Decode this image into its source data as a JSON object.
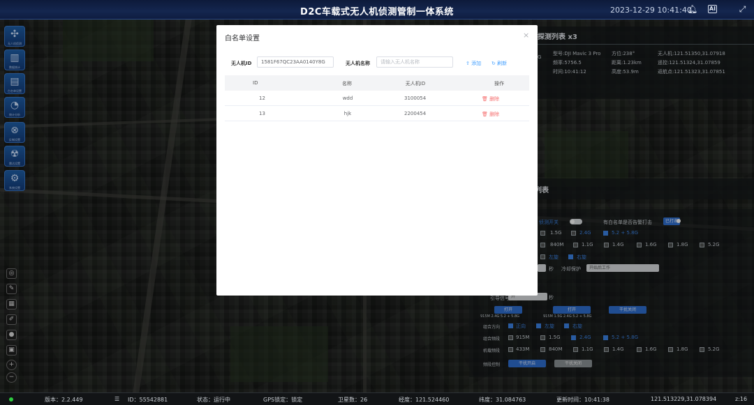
{
  "header": {
    "title": "D2C车载式无人机侦测管制一体系统",
    "datetime": "2023-12-29 10:41:40",
    "icons": [
      "bell-icon",
      "ai-icon",
      "fullscreen-icon"
    ]
  },
  "sidebar": {
    "buttons": [
      {
        "icon": "drone-icon",
        "glyph": "✣",
        "label": "无人机侦测"
      },
      {
        "icon": "bar-chart-icon",
        "glyph": "▥",
        "label": "数据统计"
      },
      {
        "icon": "document-icon",
        "glyph": "▤",
        "label": "白名单设置"
      },
      {
        "icon": "pie-chart-icon",
        "glyph": "◔",
        "label": "统计分析"
      },
      {
        "icon": "jammer-icon",
        "glyph": "⊗",
        "label": "反制设置"
      },
      {
        "icon": "radar-icon",
        "glyph": "☢",
        "label": "雷达设置"
      },
      {
        "icon": "settings-icon",
        "glyph": "⚙",
        "label": "系统设置"
      }
    ],
    "map_tools": [
      {
        "icon": "locate-icon",
        "glyph": "◎"
      },
      {
        "icon": "measure-icon",
        "glyph": "✎"
      },
      {
        "icon": "layers-icon",
        "glyph": "▦"
      },
      {
        "icon": "brush-icon",
        "glyph": "✐"
      },
      {
        "icon": "record-icon",
        "glyph": "●"
      },
      {
        "icon": "camera-icon",
        "glyph": "▣"
      },
      {
        "icon": "zoom-in-icon",
        "glyph": "+"
      },
      {
        "icon": "zoom-out-icon",
        "glyph": "−"
      }
    ]
  },
  "detect_panel": {
    "title": "探测列表 x3",
    "band": "G",
    "model": "型号:DJI Mavic 3 Pro",
    "azimuth": "方位:238°",
    "drone_pos": "无人机:121.51350,31.07918",
    "freq": "频率:5756.5",
    "distance": "距离:1.23km",
    "controller_pos": "遥控:121.51324,31.07859",
    "time": "时间:10:41:12",
    "height": "高度:53.9m",
    "home_pos": "返航点:121.51323,31.07851"
  },
  "control_panel": {
    "title": "列表",
    "row1_label": "侦测开关",
    "row1_right_label": "有白名单是否告警打击",
    "row1_right_btn": "已打击",
    "row2": [
      {
        "label": "1.5G",
        "on": false
      },
      {
        "label": "2.4G",
        "on": false
      },
      {
        "label": "5.2 + 5.8G",
        "on": true
      }
    ],
    "row3": [
      "840M",
      "1.1G",
      "1.4G",
      "1.6G",
      "1.8G",
      "5.2G"
    ],
    "row4": [
      {
        "label": "左旋",
        "on": false
      },
      {
        "label": "右旋",
        "on": true
      }
    ],
    "row5_unit": "秒",
    "row5_label": "冷却保护",
    "row5_select": "开始后工作",
    "row6_select": "开",
    "row6_unit": "秒",
    "row6_label": "引导信号",
    "btn_a": "打开",
    "btn_b": "打开",
    "btn_c": "干扰关闭",
    "cap_a": "915M 2.4G 5.2 + 5.8G",
    "cap_b": "915M 1.5G 2.4G 5.2 + 5.8G",
    "combo_dir_label": "组合方向",
    "combo_dir": [
      {
        "label": "正向",
        "on": true
      },
      {
        "label": "左旋",
        "on": true
      },
      {
        "label": "右旋",
        "on": true
      }
    ],
    "combo_band_label": "组合频段",
    "combo_band": [
      {
        "label": "915M",
        "on": false
      },
      {
        "label": "1.5G",
        "on": false
      },
      {
        "label": "2.4G",
        "on": true
      },
      {
        "label": "5.2 + 5.8G",
        "on": true
      }
    ],
    "jam_band_label": "机载频段",
    "jam_band": [
      "433M",
      "840M",
      "1.1G",
      "1.4G",
      "1.6G",
      "1.8G",
      "5.2G"
    ],
    "jam_ctrl_label": "频段控制",
    "btn_on": "干扰开启",
    "btn_off": "干扰关闭"
  },
  "dialog": {
    "title": "白名单设置",
    "close": "×",
    "id_label": "无人机ID",
    "id_value": "1581F67QC23AA0140Y8G",
    "name_label": "无人机名称",
    "name_placeholder": "请输入无人机名称",
    "add": "添加",
    "refresh": "刷新",
    "columns": [
      "ID",
      "名称",
      "无人机ID",
      "操作"
    ],
    "rows": [
      {
        "id": "12",
        "name": "wdd",
        "drone_id": "3100054",
        "action": "删除"
      },
      {
        "id": "13",
        "name": "hjk",
        "drone_id": "2200454",
        "action": "删除"
      }
    ]
  },
  "status_bar": {
    "version": "版本：2.2.449",
    "id": "ID：55542881",
    "state": "状态：运行中",
    "gps": "GPS锁定：锁定",
    "satellites": "卫星数：26",
    "longitude": "经度：121.524460",
    "latitude": "纬度：31.084763",
    "update_time": "更新时间：10:41:38",
    "coords": "121.513229,31.078394",
    "zoom": "z:16"
  }
}
